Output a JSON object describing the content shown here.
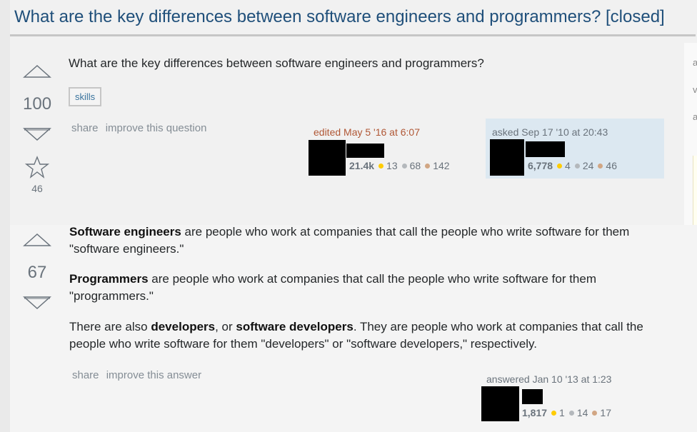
{
  "question": {
    "title": "What are the key differences between software engineers and programmers? [closed]",
    "body": "What are the key differences between software engineers and programmers?",
    "votes": "100",
    "favorites": "46",
    "tags": [
      "skills"
    ],
    "menu": {
      "share": "share",
      "improve": "improve this question"
    },
    "edited": {
      "label": "edited May 5 '16 at 6:07",
      "rep": "21.4k",
      "gold": "13",
      "silver": "68",
      "bronze": "142"
    },
    "asked": {
      "label": "asked Sep 17 '10 at 20:43",
      "rep": "6,778",
      "gold": "4",
      "silver": "24",
      "bronze": "46"
    }
  },
  "answer": {
    "votes": "67",
    "p1": {
      "term": "Software engineers",
      "rest": " are people who work at companies that call the people who write software for them \"software engineers.\""
    },
    "p2": {
      "term": "Programmers",
      "rest": " are people who work at companies that call the people who write software for them \"programmers.\""
    },
    "p3": {
      "lead": "There are also ",
      "term1": "developers",
      "mid": ", or ",
      "term2": "software developers",
      "rest": ". They are people who work at companies that call the people who write software for them \"developers\" or \"software developers,\" respectively."
    },
    "menu": {
      "share": "share",
      "improve": "improve this answer"
    },
    "answered": {
      "label": "answered Jan 10 '13 at 1:23",
      "rep": "1,817",
      "gold": "1",
      "silver": "14",
      "bronze": "17"
    }
  },
  "sidebar": {
    "letters": [
      "a",
      "v",
      "a"
    ]
  },
  "colors": {
    "link": "#39739d",
    "title": "#1f4f7a",
    "owner_bg": "#dce8f1",
    "gold": "#ffcc01",
    "silver": "#b4b8bc",
    "bronze": "#d1a684"
  }
}
